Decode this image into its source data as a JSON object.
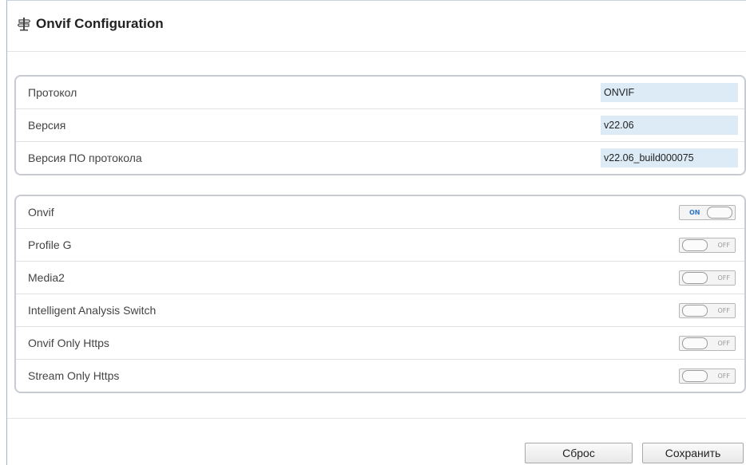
{
  "header": {
    "title": "Onvif Configuration",
    "icon": "signpost-icon"
  },
  "protocol_info": [
    {
      "label": "Протокол",
      "value": "ONVIF"
    },
    {
      "label": "Версия",
      "value": "v22.06"
    },
    {
      "label": "Версия ПО протокола",
      "value": "v22.06_build000075"
    }
  ],
  "switches": [
    {
      "label": "Onvif",
      "state": "ON"
    },
    {
      "label": "Profile G",
      "state": "OFF"
    },
    {
      "label": "Media2",
      "state": "OFF"
    },
    {
      "label": "Intelligent Analysis Switch",
      "state": "OFF"
    },
    {
      "label": "Onvif Only Https",
      "state": "OFF"
    },
    {
      "label": "Stream Only Https",
      "state": "OFF"
    }
  ],
  "buttons": {
    "reset": "Сброс",
    "save": "Сохранить"
  },
  "colors": {
    "field_bg": "#dcebf6",
    "on_text": "#2f76c2",
    "panel_border": "#c8ccd2"
  }
}
